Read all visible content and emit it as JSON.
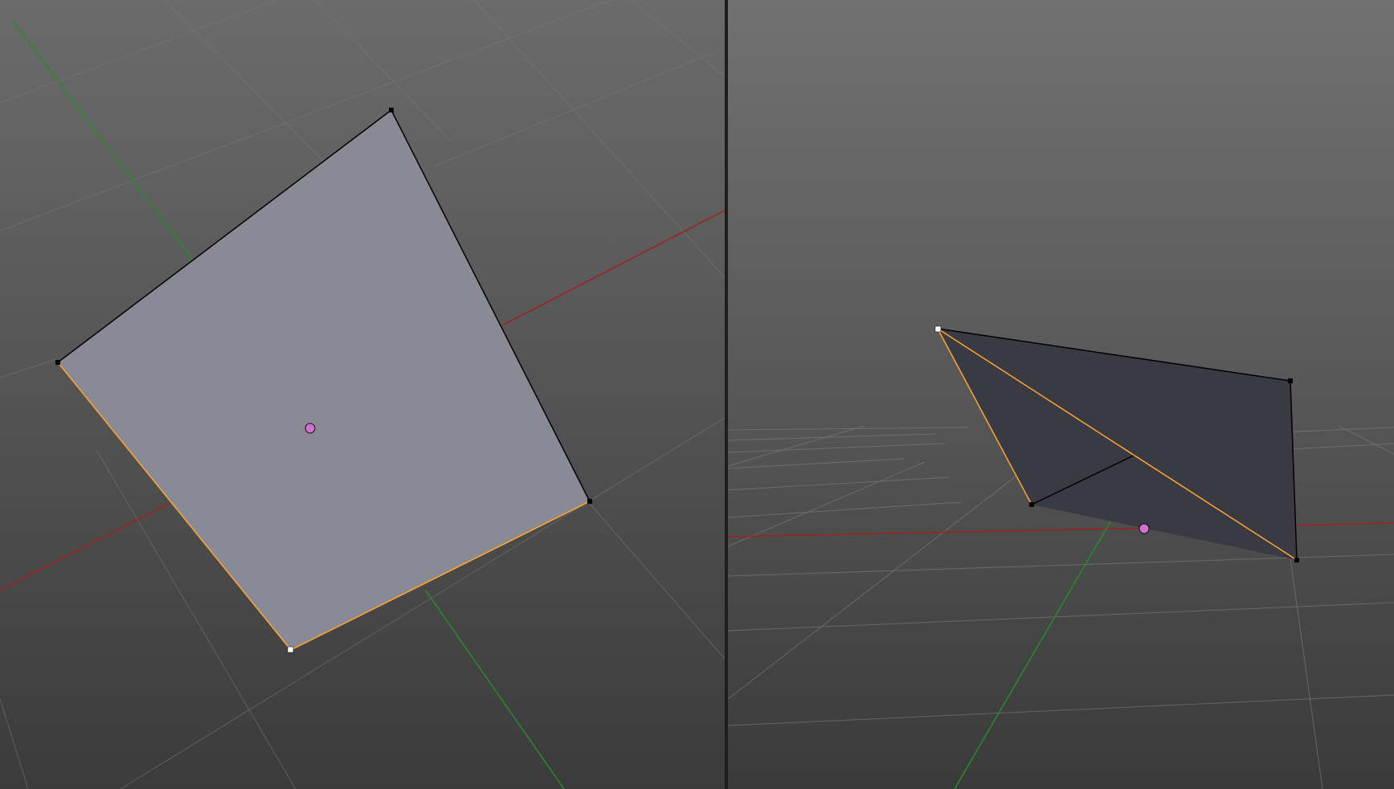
{
  "app": {
    "kind": "3d-modeling-editor",
    "mode": "edit-mode-vertex-select"
  },
  "colors": {
    "viewport_bg_top": "#6b6b6b",
    "viewport_bg_bottom": "#3b3b3b",
    "grid_line": "#7a7a7a",
    "x_axis": "#a02020",
    "y_axis": "#2a8a2a",
    "face_left": "#8a8a96",
    "face_right": "#3a3a44",
    "edge": "#000000",
    "selected_edge": "#ffa62b",
    "selected_vertex": "#ffffff",
    "origin_point": "#d070d0",
    "splitter": "#1e1e1e"
  },
  "viewports": [
    {
      "name": "viewport-left",
      "view": "top-perspective",
      "selected_vertex_count": 1,
      "object": "plane"
    },
    {
      "name": "viewport-right",
      "view": "side-perspective",
      "selected_vertex_count": 1,
      "object": "plane"
    }
  ]
}
